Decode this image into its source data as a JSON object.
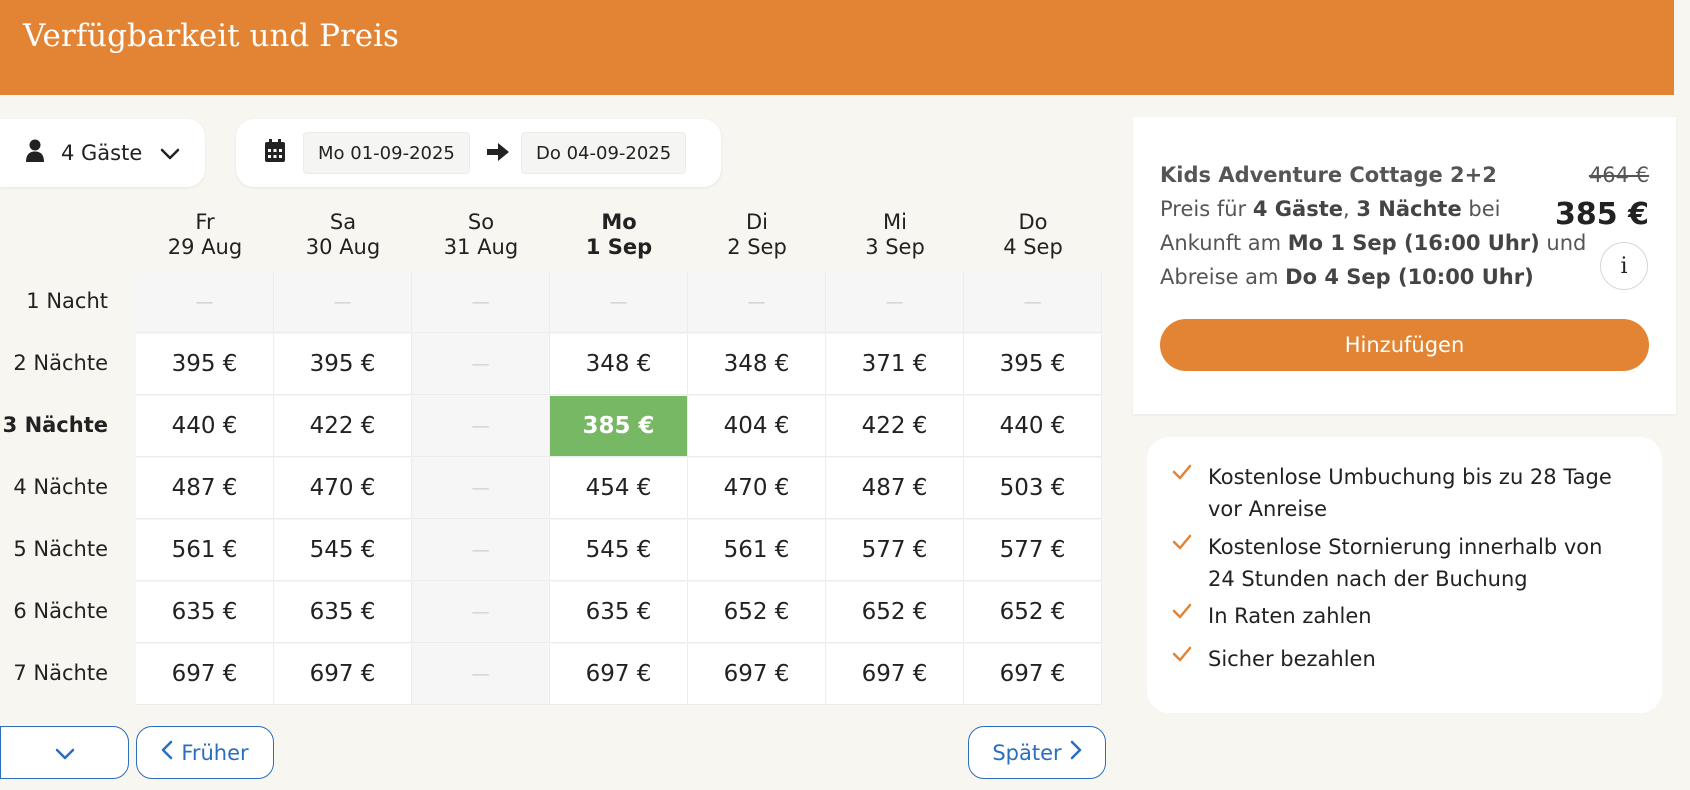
{
  "header": {
    "title": "Verfügbarkeit und Preis"
  },
  "search": {
    "guests_label": "4 Gäste",
    "date_from": "Mo 01-09-2025",
    "date_to": "Do 04-09-2025"
  },
  "calendar": {
    "columns": [
      {
        "day": "Fr",
        "date": "29 Aug"
      },
      {
        "day": "Sa",
        "date": "30 Aug"
      },
      {
        "day": "So",
        "date": "31 Aug"
      },
      {
        "day": "Mo",
        "date": "1 Sep"
      },
      {
        "day": "Di",
        "date": "2 Sep"
      },
      {
        "day": "Mi",
        "date": "3 Sep"
      },
      {
        "day": "Do",
        "date": "4 Sep"
      }
    ],
    "selected_column": 3,
    "selected_row": 2,
    "rows": [
      {
        "label": "1 Nacht",
        "prices": [
          "—",
          "—",
          "—",
          "—",
          "—",
          "—",
          "—"
        ]
      },
      {
        "label": "2 Nächte",
        "prices": [
          "395 €",
          "395 €",
          "—",
          "348 €",
          "348 €",
          "371 €",
          "395 €"
        ]
      },
      {
        "label": "3 Nächte",
        "prices": [
          "440 €",
          "422 €",
          "—",
          "385 €",
          "404 €",
          "422 €",
          "440 €"
        ]
      },
      {
        "label": "4 Nächte",
        "prices": [
          "487 €",
          "470 €",
          "—",
          "454 €",
          "470 €",
          "487 €",
          "503 €"
        ]
      },
      {
        "label": "5 Nächte",
        "prices": [
          "561 €",
          "545 €",
          "—",
          "545 €",
          "561 €",
          "577 €",
          "577 €"
        ]
      },
      {
        "label": "6 Nächte",
        "prices": [
          "635 €",
          "635 €",
          "—",
          "635 €",
          "652 €",
          "652 €",
          "652 €"
        ]
      },
      {
        "label": "7 Nächte",
        "prices": [
          "697 €",
          "697 €",
          "—",
          "697 €",
          "697 €",
          "697 €",
          "697 €"
        ]
      }
    ]
  },
  "nav": {
    "earlier_label": "Früher",
    "later_label": "Später"
  },
  "summary": {
    "name": "Kids Adventure Cottage 2+2",
    "old_price": "464 €",
    "price": "385 €",
    "line1_pre": "Preis für ",
    "guests": "4 Gäste",
    "line1_sep": ", ",
    "nights": "3 Nächte",
    "line1_post": " bei",
    "line2_pre": "Ankunft am ",
    "arrival": "Mo 1 Sep (16:00 Uhr)",
    "line2_post": " und",
    "line3_pre": "Abreise am ",
    "departure": "Do 4 Sep (10:00 Uhr)",
    "info_label": "i",
    "add_button": "Hinzufügen"
  },
  "features": [
    "Kostenlose Umbuchung bis zu 28 Tage vor Anreise",
    "Kostenlose Stornierung innerhalb von 24 Stunden nach der Buchung",
    "In Raten zahlen",
    "Sicher bezahlen"
  ],
  "colors": {
    "accent": "#e28433",
    "selected_cell": "#77b865",
    "link": "#2a6ebd",
    "background": "#f8f6f1"
  }
}
